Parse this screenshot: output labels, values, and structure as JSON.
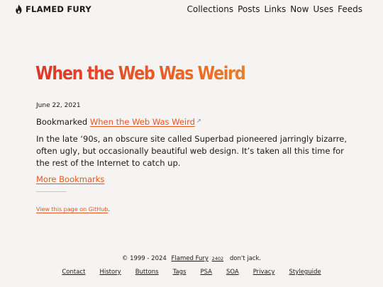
{
  "header": {
    "brand_icon": "flame-icon",
    "brand": "FLAMED FURY",
    "nav": [
      "Collections",
      "Posts",
      "Links",
      "Now",
      "Uses",
      "Feeds"
    ]
  },
  "post": {
    "title": "When the Web Was Weird",
    "date": "June 22, 2021",
    "bookmark_prefix": "Bookmarked",
    "bookmark_link": "When the Web Was Weird",
    "external_icon": "↗",
    "body": "In the late ‘90s, an obscure site called Superbad pioneered jarringly bizarre, often ugly, but occasionally beautiful web design. It’s taken all this time for the rest of the Internet to catch up.",
    "more_link": "More Bookmarks",
    "github_link": "View this page on GitHub",
    "github_suffix": "."
  },
  "footer": {
    "copyright": "© 1999 - 2024",
    "site_link": "Flamed Fury",
    "version": "2402",
    "tagline": "don't jack.",
    "links": [
      "Contact",
      "History",
      "Buttons",
      "Tags",
      "PSA",
      "SOA",
      "Privacy",
      "Styleguide"
    ],
    "icons": [
      "rss-icon",
      "bookmark-icon",
      "instagram-icon",
      "discord-icon"
    ]
  },
  "colors": {
    "background": "#f5f4f2",
    "text": "#1a1a1a",
    "accent": "#e8541c",
    "title_gradient_start": "#e0352a",
    "title_gradient_end": "#ee7d25"
  }
}
